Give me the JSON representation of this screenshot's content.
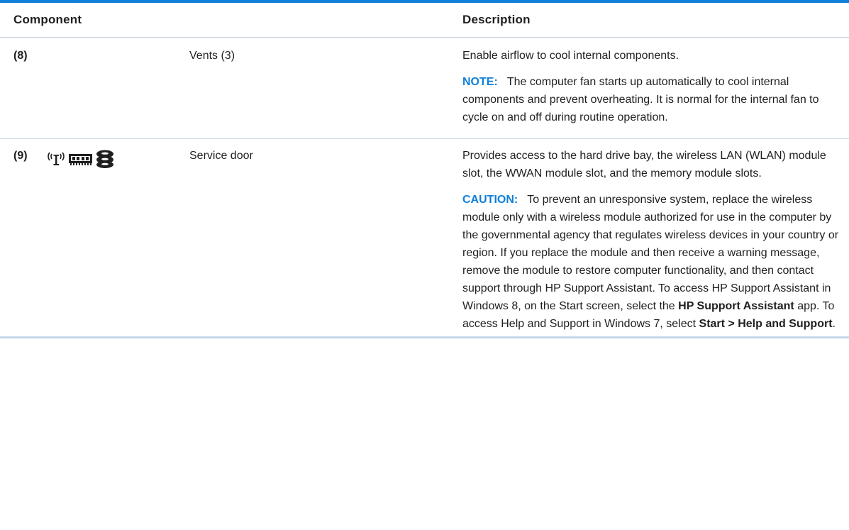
{
  "table": {
    "header": {
      "component": "Component",
      "description": "Description"
    },
    "rows": [
      {
        "number": "(8)",
        "name": "Vents (3)",
        "icons": [],
        "description": "Enable airflow to cool internal components.",
        "note": {
          "label": "NOTE:",
          "text": "The computer fan starts up automatically to cool internal components and prevent overheating. It is normal for the internal fan to cycle on and off during routine operation."
        }
      },
      {
        "number": "(9)",
        "name": "Service door",
        "icons": [
          "wireless-antenna-icon",
          "memory-module-icon",
          "hard-drive-icon"
        ],
        "description": "Provides access to the hard drive bay, the wireless LAN (WLAN) module slot, the WWAN module slot, and the memory module slots.",
        "caution": {
          "label": "CAUTION:",
          "text_1": "To prevent an unresponsive system, replace the wireless module only with a wireless module authorized for use in the computer by the governmental agency that regulates wireless devices in your country or region. If you replace the module and then receive a warning message, remove the module to restore computer functionality, and then contact support through HP Support Assistant. To access HP Support Assistant in Windows 8, on the Start screen, select the",
          "app_name": "HP Support Assistant",
          "text_2": "app. To access Help and Support in Windows 7, select",
          "menu_path": "Start > Help and Support",
          "text_3": "."
        }
      }
    ]
  },
  "colors": {
    "accent": "#0f7fd9",
    "text": "#1f1f1f",
    "rule": "#cdd9e6"
  }
}
